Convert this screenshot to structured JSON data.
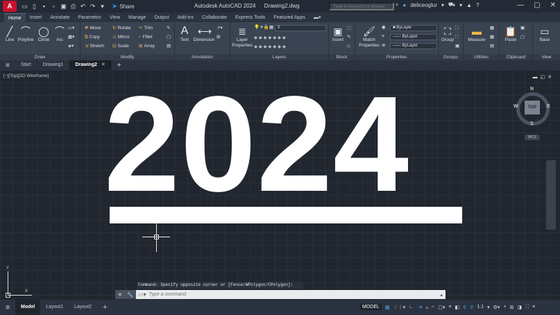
{
  "app": {
    "logo": "A",
    "title": "Autodesk AutoCAD 2024",
    "document": "Drawing2.dwg",
    "share_label": "Share"
  },
  "search": {
    "placeholder": "Type a keyword or phrase"
  },
  "user": {
    "name": "deliceoglur"
  },
  "ribbon_tabs": [
    "Home",
    "Insert",
    "Annotate",
    "Parametric",
    "View",
    "Manage",
    "Output",
    "Add-ins",
    "Collaborate",
    "Express Tools",
    "Featured Apps"
  ],
  "panels": {
    "draw": {
      "title": "Draw",
      "line": "Line",
      "polyline": "Polyline",
      "circle": "Circle",
      "arc": "Arc"
    },
    "modify": {
      "title": "Modify",
      "move": "Move",
      "rotate": "Rotate",
      "trim": "Trim",
      "copy": "Copy",
      "mirror": "Mirror",
      "fillet": "Fillet",
      "stretch": "Stretch",
      "scale": "Scale",
      "array": "Array"
    },
    "annotation": {
      "title": "Annotation",
      "text": "Text",
      "dimension": "Dimension"
    },
    "layers": {
      "title": "Layers",
      "layer_properties_1": "Layer",
      "layer_properties_2": "Properties",
      "current_layer": "0"
    },
    "block": {
      "title": "Block",
      "insert": "Insert"
    },
    "properties": {
      "title": "Properties",
      "match_1": "Match",
      "match_2": "Properties",
      "color": "ByLayer",
      "linetype": "ByLayer",
      "lineweight": "ByLayer"
    },
    "groups": {
      "title": "Groups",
      "group": "Group"
    },
    "utilities": {
      "title": "Utilities",
      "measure": "Measure"
    },
    "clipboard": {
      "title": "Clipboard",
      "paste": "Paste"
    },
    "view": {
      "title": "View",
      "base": "Base"
    }
  },
  "doc_tabs": {
    "start": "Start",
    "drawing1": "Drawing1",
    "drawing2": "Drawing2"
  },
  "viewport": {
    "label": "[−][Top][2D Wireframe]",
    "year_text": "2024",
    "viewcube": {
      "top": "TOP",
      "n": "N",
      "s": "S",
      "e": "E",
      "w": "W",
      "wcs": "WCS"
    },
    "ucs": {
      "x": "X",
      "y": "Y"
    }
  },
  "command": {
    "history": "Command: Specify opposite corner or [Fence/WPolygon/CPolygon]:",
    "placeholder": "Type a command"
  },
  "status": {
    "tabs": [
      "Model",
      "Layout1",
      "Layout2"
    ],
    "model_label": "MODEL",
    "scale": "1:1"
  }
}
